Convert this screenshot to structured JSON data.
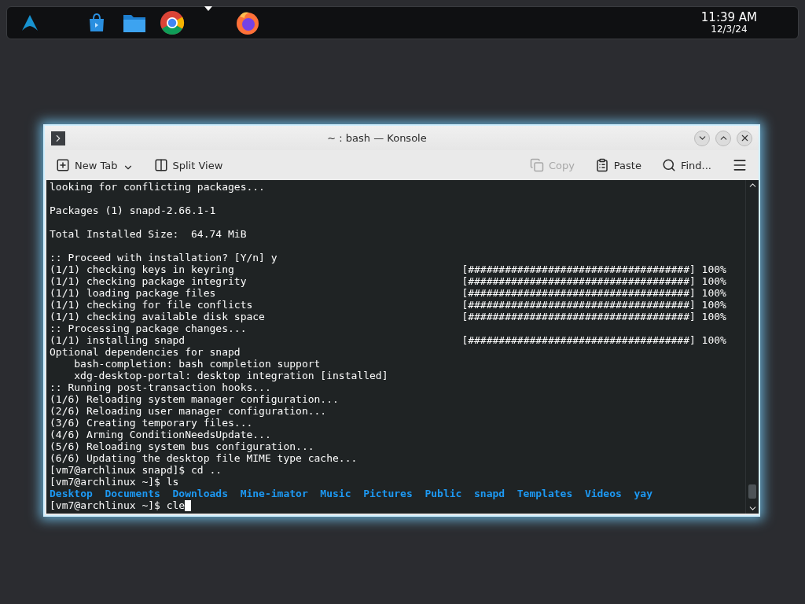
{
  "panel": {
    "clock": {
      "time": "11:39 AM",
      "date": "12/3/24"
    }
  },
  "window": {
    "title": "~ : bash — Konsole",
    "toolbar": [
      {
        "kind": "new-tab",
        "label": "New Tab",
        "disabled": false
      },
      {
        "kind": "split-view",
        "label": "Split View",
        "disabled": false
      },
      {
        "kind": "copy",
        "label": "Copy",
        "disabled": true
      },
      {
        "kind": "paste",
        "label": "Paste",
        "disabled": false
      },
      {
        "kind": "find",
        "label": "Find...",
        "disabled": false
      }
    ],
    "terminal": {
      "lines": [
        {
          "kind": "text",
          "text": "looking for conflicting packages..."
        },
        {
          "kind": "blank"
        },
        {
          "kind": "text",
          "text": "Packages (1) snapd-2.66.1-1"
        },
        {
          "kind": "blank"
        },
        {
          "kind": "text",
          "text": "Total Installed Size:  64.74 MiB"
        },
        {
          "kind": "blank"
        },
        {
          "kind": "text",
          "text": ":: Proceed with installation? [Y/n] y"
        },
        {
          "kind": "progress",
          "text": "(1/1) checking keys in keyring",
          "bar": "[####################################]",
          "percent": "100%"
        },
        {
          "kind": "progress",
          "text": "(1/1) checking package integrity",
          "bar": "[####################################]",
          "percent": "100%"
        },
        {
          "kind": "progress",
          "text": "(1/1) loading package files",
          "bar": "[####################################]",
          "percent": "100%"
        },
        {
          "kind": "progress",
          "text": "(1/1) checking for file conflicts",
          "bar": "[####################################]",
          "percent": "100%"
        },
        {
          "kind": "progress",
          "text": "(1/1) checking available disk space",
          "bar": "[####################################]",
          "percent": "100%"
        },
        {
          "kind": "text",
          "text": ":: Processing package changes..."
        },
        {
          "kind": "progress",
          "text": "(1/1) installing snapd",
          "bar": "[####################################]",
          "percent": "100%"
        },
        {
          "kind": "text",
          "text": "Optional dependencies for snapd"
        },
        {
          "kind": "indented",
          "text": "bash-completion: bash completion support"
        },
        {
          "kind": "indented",
          "text": "xdg-desktop-portal: desktop integration [installed]"
        },
        {
          "kind": "text",
          "text": ":: Running post-transaction hooks..."
        },
        {
          "kind": "text",
          "text": "(1/6) Reloading system manager configuration..."
        },
        {
          "kind": "text",
          "text": "(2/6) Reloading user manager configuration..."
        },
        {
          "kind": "text",
          "text": "(3/6) Creating temporary files..."
        },
        {
          "kind": "text",
          "text": "(4/6) Arming ConditionNeedsUpdate..."
        },
        {
          "kind": "text",
          "text": "(5/6) Reloading system bus configuration..."
        },
        {
          "kind": "text",
          "text": "(6/6) Updating the desktop file MIME type cache..."
        },
        {
          "kind": "text",
          "text": "[vm7@archlinux snapd]$ cd .."
        },
        {
          "kind": "text",
          "text": "[vm7@archlinux ~]$ ls"
        },
        {
          "kind": "listing",
          "items": [
            "Desktop",
            "Documents",
            "Downloads",
            "Mine-imator",
            "Music",
            "Pictures",
            "Public",
            "snapd",
            "Templates",
            "Videos",
            "yay"
          ]
        },
        {
          "kind": "prompt",
          "text": "[vm7@archlinux ~]$ cle",
          "cursor": true
        }
      ]
    }
  }
}
